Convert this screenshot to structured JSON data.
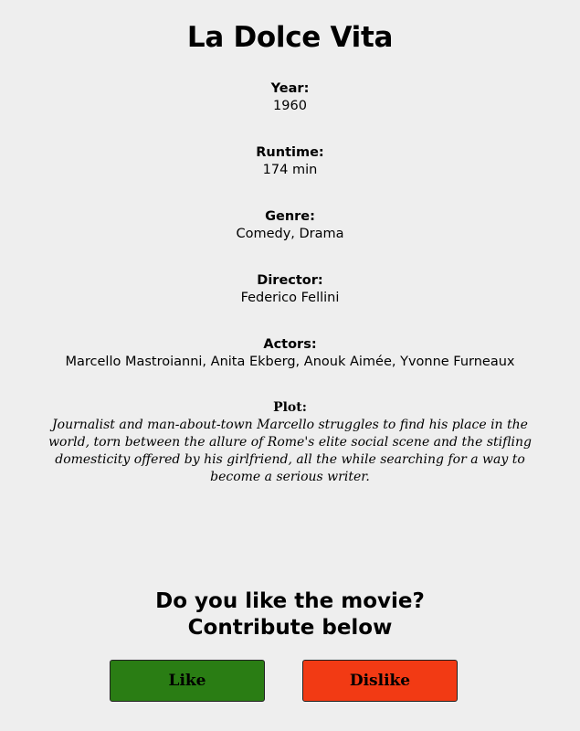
{
  "movie": {
    "title": "La Dolce Vita",
    "fields": {
      "year": {
        "label": "Year:",
        "value": "1960"
      },
      "runtime": {
        "label": "Runtime:",
        "value": "174 min"
      },
      "genre": {
        "label": "Genre:",
        "value": "Comedy, Drama"
      },
      "director": {
        "label": "Director:",
        "value": "Federico Fellini"
      },
      "actors": {
        "label": "Actors:",
        "value": "Marcello Mastroianni, Anita Ekberg, Anouk Aimée, Yvonne Furneaux"
      },
      "plot": {
        "label": "Plot:",
        "value": "Journalist and man-about-town Marcello struggles to find his place in the world, torn between the allure of Rome's elite social scene and the stifling domesticity offered by his girlfriend, all the while searching for a way to become a serious writer."
      }
    }
  },
  "contribute": {
    "line1": "Do you like the movie?",
    "line2": "Contribute below",
    "like_label": "Like",
    "dislike_label": "Dislike"
  },
  "colors": {
    "background": "#eeeeee",
    "like_button": "#2a7d14",
    "dislike_button": "#f23a14"
  }
}
